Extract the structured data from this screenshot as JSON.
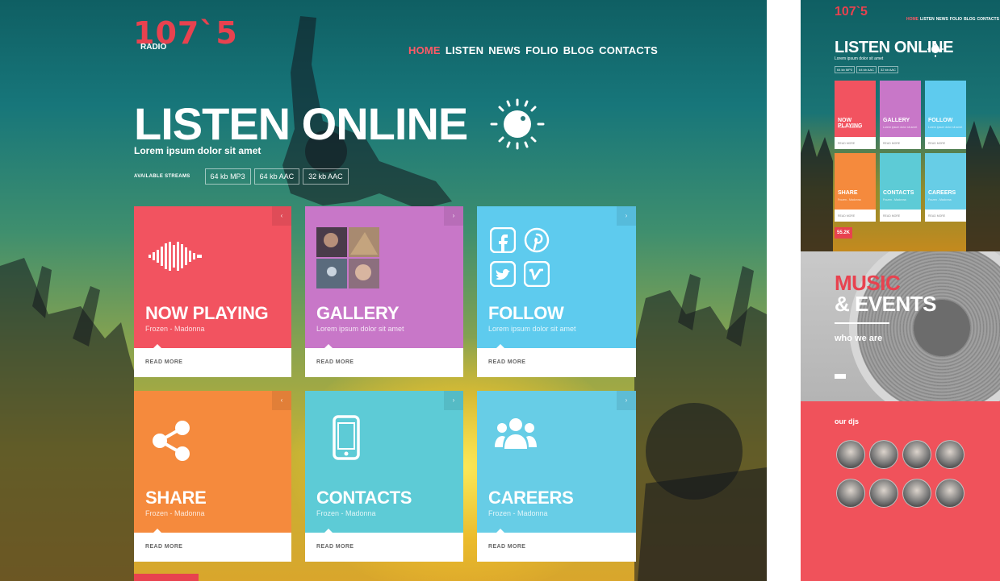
{
  "brand": {
    "logo": "107`5",
    "logo_sub": "RADIO"
  },
  "nav": [
    "HOME",
    "LISTEN",
    "NEWS",
    "FOLIO",
    "BLOG",
    "CONTACTS"
  ],
  "hero": {
    "headline": "LISTEN ONLINE",
    "subtitle": "Lorem ipsum dolor sit amet",
    "streams_label": "AVAILABLE STREAMS",
    "streams": [
      "64 kb MP3",
      "64 kb AAC",
      "32 kb AAC"
    ]
  },
  "tiles": [
    {
      "title": "NOW PLAYING",
      "caption": "Frozen - Madonna",
      "footer": "READ MORE",
      "color": "#f25360",
      "icon": "sound-wave-icon"
    },
    {
      "title": "GALLERY",
      "caption": "Lorem ipsum dolor sit amet",
      "footer": "READ MORE",
      "color": "#c877c8",
      "icon": "photo-collage-icon"
    },
    {
      "title": "FOLLOW",
      "caption": "Lorem ipsum dolor sit amet",
      "footer": "READ MORE",
      "color": "#5ecbee",
      "icon": "social-icons"
    },
    {
      "title": "SHARE",
      "caption": "Frozen - Madonna",
      "footer": "READ MORE",
      "color": "#f58a3d",
      "icon": "share-icon"
    },
    {
      "title": "CONTACTS",
      "caption": "Frozen - Madonna",
      "footer": "READ MORE",
      "color": "#5dcbd6",
      "icon": "phone-icon"
    },
    {
      "title": "CAREERS",
      "caption": "Frozen - Madonna",
      "footer": "READ MORE",
      "color": "#67cde6",
      "icon": "people-icon"
    }
  ],
  "preview": {
    "count": "55.2K",
    "music": "MUSIC",
    "events": "& EVENTS",
    "who_title": "who we are",
    "djs_title": "our djs"
  },
  "colors": {
    "accent": "#e8424f",
    "coral": "#f0525b"
  }
}
